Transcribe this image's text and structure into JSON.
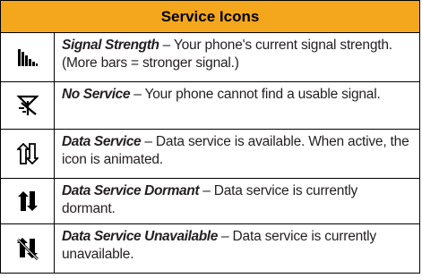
{
  "header": {
    "title": "Service Icons"
  },
  "rows": [
    {
      "name": "Signal Strength",
      "description": " – Your phone's current signal strength. (More bars = stronger signal.)",
      "icon": "signal-strength-icon"
    },
    {
      "name": "No Service",
      "description": " – Your phone cannot find a usable signal.",
      "icon": "no-service-icon"
    },
    {
      "name": "Data Service",
      "description": " – Data service is available. When active, the icon is animated.",
      "icon": "data-service-icon"
    },
    {
      "name": "Data Service Dormant",
      "description": " – Data service is currently dormant.",
      "icon": "data-service-dormant-icon"
    },
    {
      "name": "Data Service Unavailable",
      "description": " – Data service is currently unavailable.",
      "icon": "data-service-unavailable-icon"
    }
  ],
  "colors": {
    "header_bg": "#f4a71d",
    "border": "#000000",
    "text": "#231f20"
  }
}
